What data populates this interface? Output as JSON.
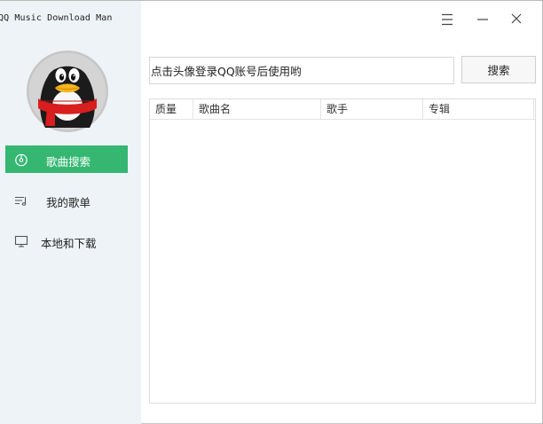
{
  "window": {
    "title": "QQ Music Download Man"
  },
  "sidebar": {
    "items": [
      {
        "label": "歌曲搜索",
        "icon": "music-disc-icon",
        "active": true
      },
      {
        "label": "我的歌单",
        "icon": "playlist-icon",
        "active": false
      },
      {
        "label": "本地和下载",
        "icon": "monitor-icon",
        "active": false
      }
    ]
  },
  "search": {
    "value": "点击头像登录QQ账号后使用哟",
    "button_label": "搜索"
  },
  "table": {
    "columns": [
      "质量",
      "歌曲名",
      "歌手",
      "专辑"
    ],
    "rows": []
  },
  "controls": {
    "menu_icon": "menu-icon",
    "minimize_icon": "minimize-icon",
    "close_icon": "close-icon"
  },
  "colors": {
    "accent": "#35b772",
    "sidebar_bg": "#eef3f7"
  }
}
